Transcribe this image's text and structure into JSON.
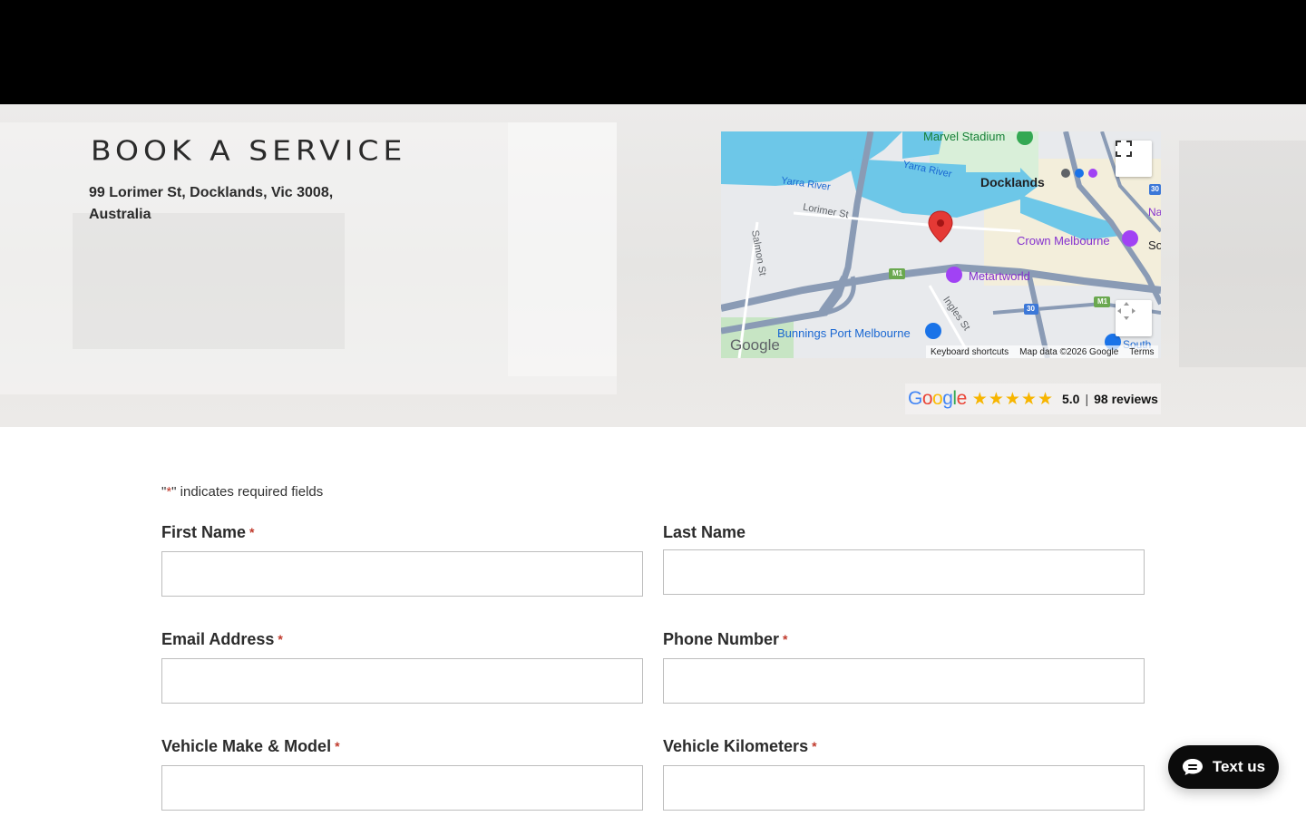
{
  "hero": {
    "title": "BOOK A SERVICE",
    "address_line1": "99 Lorimer St, Docklands, Vic 3008,",
    "address_line2": "Australia"
  },
  "map": {
    "labels": {
      "marvel_stadium": "Marvel Stadium",
      "yarra_river_1": "Yarra River",
      "yarra_river_2": "Yarra River",
      "docklands": "Docklands",
      "lorimer_st": "Lorimer St",
      "salmon_st": "Salmon St",
      "crown_melbourne": "Crown Melbourne",
      "metartworld": "Metartworld",
      "ingles_st": "Ingles St",
      "bunnings": "Bunnings Port Melbourne",
      "south": "South",
      "so": "So",
      "na": "Na",
      "m1_a": "M1",
      "m1_b": "M1",
      "route_30_a": "30",
      "route_30_b": "30"
    },
    "logo": "Google",
    "keyboard_shortcuts": "Keyboard shortcuts",
    "map_data": "Map data ©2026 Google",
    "terms": "Terms"
  },
  "reviews": {
    "provider": "Google",
    "rating": "5.0",
    "rating_value": 5.0,
    "max_stars": 5,
    "separator": "|",
    "count": "98 reviews"
  },
  "form": {
    "required_note_prefix": "\"",
    "required_note_asterisk": "*",
    "required_note_suffix": "\" indicates required fields",
    "required_marker": "*",
    "fields": {
      "first_name": {
        "label": "First Name",
        "value": ""
      },
      "last_name": {
        "label": "Last Name",
        "value": ""
      },
      "email": {
        "label": "Email Address",
        "value": ""
      },
      "phone": {
        "label": "Phone Number",
        "value": ""
      },
      "vehicle": {
        "label": "Vehicle Make & Model",
        "value": ""
      },
      "kilometers": {
        "label": "Vehicle Kilometers",
        "value": ""
      }
    }
  },
  "chat": {
    "label": "Text us"
  },
  "colors": {
    "accent_required": "#c0392b",
    "star": "#f7b500",
    "water": "#6dc7e8",
    "road": "#8a9bb5",
    "marker": "#e53935"
  }
}
